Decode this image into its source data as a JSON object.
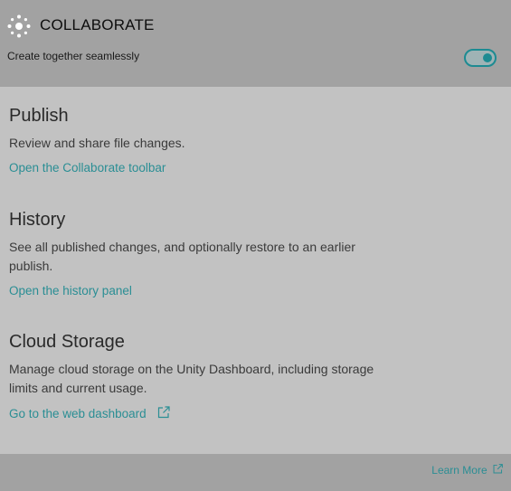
{
  "header": {
    "icon": "collaborate-icon",
    "title": "COLLABORATE",
    "subtitle": "Create together seamlessly",
    "toggle_state": "on",
    "accent_color": "#1d8b92"
  },
  "sections": [
    {
      "heading": "Publish",
      "description": "Review and share file changes.",
      "link": "Open the Collaborate toolbar"
    },
    {
      "heading": "History",
      "description": "See all published changes, and optionally restore to an earlier publish.",
      "link": "Open the history panel"
    },
    {
      "heading": "Cloud Storage",
      "description": "Manage cloud storage on the Unity Dashboard, including storage limits and current usage.",
      "link": "Go to the web dashboard",
      "link_icon": "external-link-icon"
    }
  ],
  "footer": {
    "learn_more": "Learn More",
    "learn_more_icon": "external-link-icon"
  },
  "colors": {
    "header_bg": "#a2a2a2",
    "content_bg": "#c2c2c2",
    "link": "#2a8e94"
  }
}
